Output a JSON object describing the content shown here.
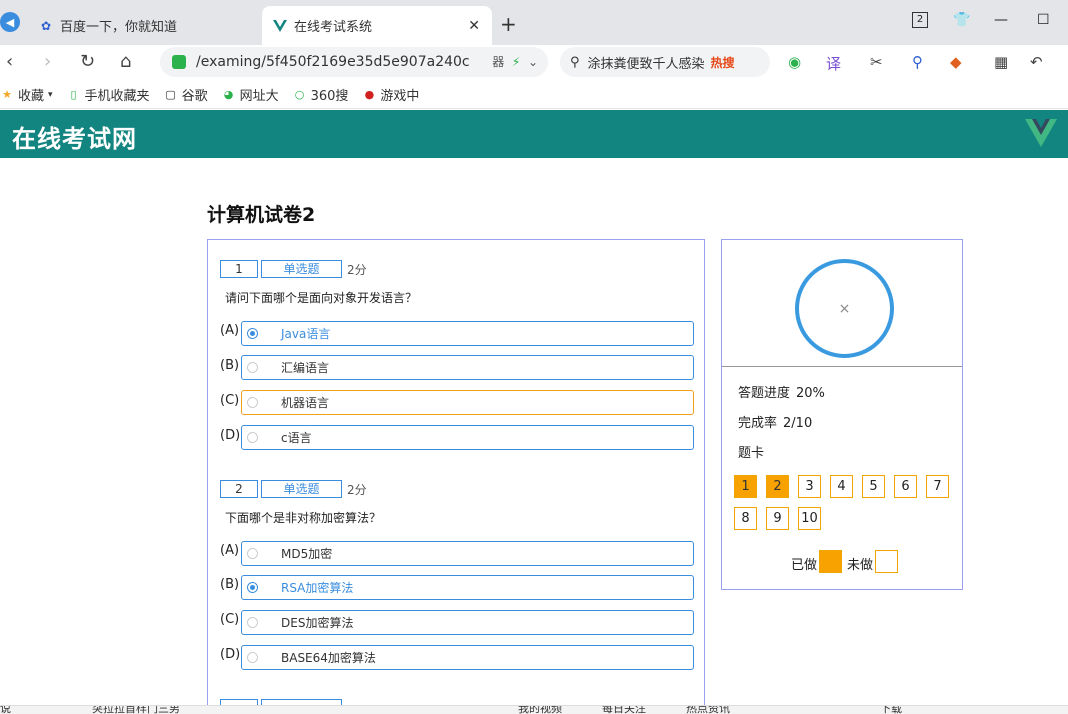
{
  "browser": {
    "tabs": [
      {
        "label": "百度一下，你就知道",
        "icon": "baidu-paw-icon"
      },
      {
        "label": "在线考试系统",
        "icon": "vue-v-icon"
      }
    ],
    "window_badge": "2",
    "url": "/examing/5f450f2169e35d5e907a240c",
    "url_tail": "器",
    "search_text": "涂抹粪便致千人感染",
    "search_hot": "热搜",
    "bookmarks": [
      "收藏",
      "手机收藏夹",
      "谷歌",
      "网址大",
      "360搜",
      "游戏中"
    ]
  },
  "app": {
    "brand": "在线考试网",
    "accent": "#138580"
  },
  "exam": {
    "title": "计算机试卷2",
    "questions": [
      {
        "number": "1",
        "type": "单选题",
        "score": "2分",
        "text": "请问下面哪个是面向对象开发语言？",
        "options": [
          {
            "letter": "(A)",
            "label": "Java语言",
            "selected": true
          },
          {
            "letter": "(B)",
            "label": "汇编语言",
            "selected": false
          },
          {
            "letter": "(C)",
            "label": "机器语言",
            "selected": false
          },
          {
            "letter": "(D)",
            "label": "c语言",
            "selected": false
          }
        ]
      },
      {
        "number": "2",
        "type": "单选题",
        "score": "2分",
        "text": "下面哪个是非对称加密算法？",
        "options": [
          {
            "letter": "(A)",
            "label": "MD5加密",
            "selected": false
          },
          {
            "letter": "(B)",
            "label": "RSA加密算法",
            "selected": true
          },
          {
            "letter": "(C)",
            "label": "DES加密算法",
            "selected": false
          },
          {
            "letter": "(D)",
            "label": "BASE64加密算法",
            "selected": false
          }
        ]
      }
    ]
  },
  "side": {
    "progress_label": "答题进度",
    "progress_value": "20%",
    "completion_label": "完成率",
    "completion_value": "2/10",
    "card_label": "题卡",
    "cards": [
      {
        "n": "1",
        "done": true
      },
      {
        "n": "2",
        "done": true
      },
      {
        "n": "3",
        "done": false
      },
      {
        "n": "4",
        "done": false
      },
      {
        "n": "5",
        "done": false
      },
      {
        "n": "6",
        "done": false
      },
      {
        "n": "7",
        "done": false
      },
      {
        "n": "8",
        "done": false
      },
      {
        "n": "9",
        "done": false
      },
      {
        "n": "10",
        "done": false
      }
    ],
    "legend_done": "已做",
    "legend_todo": "未做",
    "done_color": "#f7a200"
  },
  "statusbar": {
    "items": [
      "说",
      "突拉拉首样门三男",
      "我的视频",
      "每日关注",
      "热点资讯",
      "下载"
    ]
  }
}
